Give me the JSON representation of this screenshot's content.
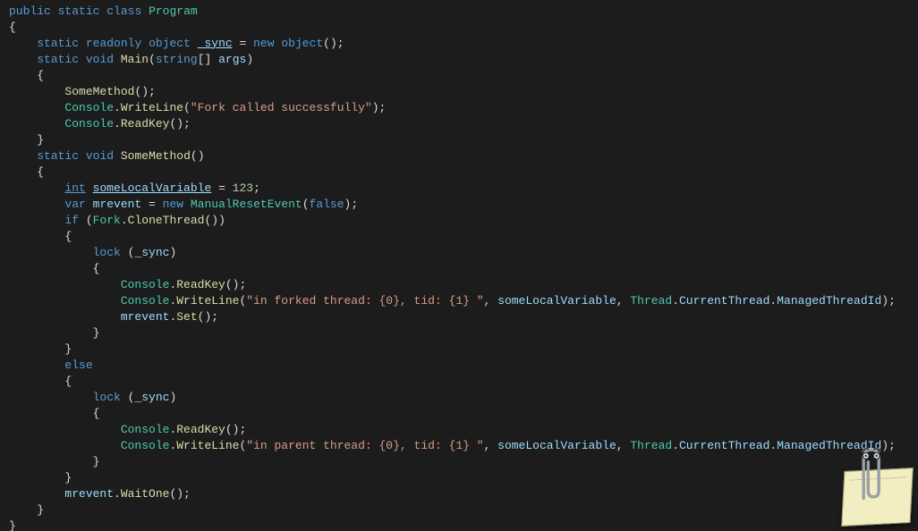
{
  "code": {
    "lines": [
      {
        "indent": 0,
        "tokens": [
          {
            "c": "kw",
            "t": "public"
          },
          {
            "c": "punct",
            "t": " "
          },
          {
            "c": "kw",
            "t": "static"
          },
          {
            "c": "punct",
            "t": " "
          },
          {
            "c": "kw",
            "t": "class"
          },
          {
            "c": "punct",
            "t": " "
          },
          {
            "c": "type",
            "t": "Program"
          }
        ]
      },
      {
        "indent": 0,
        "tokens": [
          {
            "c": "punct",
            "t": "{"
          }
        ]
      },
      {
        "indent": 1,
        "tokens": [
          {
            "c": "kw",
            "t": "static"
          },
          {
            "c": "punct",
            "t": " "
          },
          {
            "c": "kw",
            "t": "readonly"
          },
          {
            "c": "punct",
            "t": " "
          },
          {
            "c": "kw",
            "t": "object"
          },
          {
            "c": "punct",
            "t": " "
          },
          {
            "c": "var underline",
            "t": "_sync"
          },
          {
            "c": "punct",
            "t": " = "
          },
          {
            "c": "kw",
            "t": "new"
          },
          {
            "c": "punct",
            "t": " "
          },
          {
            "c": "kw",
            "t": "object"
          },
          {
            "c": "punct",
            "t": "();"
          }
        ]
      },
      {
        "indent": 0,
        "tokens": [
          {
            "c": "punct",
            "t": ""
          }
        ]
      },
      {
        "indent": 1,
        "tokens": [
          {
            "c": "kw",
            "t": "static"
          },
          {
            "c": "punct",
            "t": " "
          },
          {
            "c": "kw",
            "t": "void"
          },
          {
            "c": "punct",
            "t": " "
          },
          {
            "c": "method",
            "t": "Main"
          },
          {
            "c": "punct",
            "t": "("
          },
          {
            "c": "kw",
            "t": "string"
          },
          {
            "c": "punct",
            "t": "[] "
          },
          {
            "c": "var",
            "t": "args"
          },
          {
            "c": "punct",
            "t": ")"
          }
        ]
      },
      {
        "indent": 1,
        "tokens": [
          {
            "c": "punct",
            "t": "{"
          }
        ]
      },
      {
        "indent": 2,
        "tokens": [
          {
            "c": "method",
            "t": "SomeMethod"
          },
          {
            "c": "punct",
            "t": "();"
          }
        ]
      },
      {
        "indent": 2,
        "tokens": [
          {
            "c": "type",
            "t": "Console"
          },
          {
            "c": "punct",
            "t": "."
          },
          {
            "c": "method",
            "t": "WriteLine"
          },
          {
            "c": "punct",
            "t": "("
          },
          {
            "c": "str",
            "t": "\"Fork called successfully\""
          },
          {
            "c": "punct",
            "t": ");"
          }
        ]
      },
      {
        "indent": 2,
        "tokens": [
          {
            "c": "type",
            "t": "Console"
          },
          {
            "c": "punct",
            "t": "."
          },
          {
            "c": "method",
            "t": "ReadKey"
          },
          {
            "c": "punct",
            "t": "();"
          }
        ]
      },
      {
        "indent": 1,
        "tokens": [
          {
            "c": "punct",
            "t": "}"
          }
        ]
      },
      {
        "indent": 0,
        "tokens": [
          {
            "c": "punct",
            "t": ""
          }
        ]
      },
      {
        "indent": 1,
        "tokens": [
          {
            "c": "kw",
            "t": "static"
          },
          {
            "c": "punct",
            "t": " "
          },
          {
            "c": "kw",
            "t": "void"
          },
          {
            "c": "punct",
            "t": " "
          },
          {
            "c": "method",
            "t": "SomeMethod"
          },
          {
            "c": "punct",
            "t": "()"
          }
        ]
      },
      {
        "indent": 1,
        "tokens": [
          {
            "c": "punct",
            "t": "{"
          }
        ]
      },
      {
        "indent": 2,
        "tokens": [
          {
            "c": "kw underline",
            "t": "int"
          },
          {
            "c": "punct",
            "t": " "
          },
          {
            "c": "var underline",
            "t": "someLocalVariable"
          },
          {
            "c": "punct",
            "t": " = "
          },
          {
            "c": "num",
            "t": "123"
          },
          {
            "c": "punct",
            "t": ";"
          }
        ]
      },
      {
        "indent": 2,
        "tokens": [
          {
            "c": "kw",
            "t": "var"
          },
          {
            "c": "punct",
            "t": " "
          },
          {
            "c": "var",
            "t": "mrevent"
          },
          {
            "c": "punct",
            "t": " = "
          },
          {
            "c": "kw",
            "t": "new"
          },
          {
            "c": "punct",
            "t": " "
          },
          {
            "c": "type",
            "t": "ManualResetEvent"
          },
          {
            "c": "punct",
            "t": "("
          },
          {
            "c": "kw",
            "t": "false"
          },
          {
            "c": "punct",
            "t": ");"
          }
        ]
      },
      {
        "indent": 0,
        "tokens": [
          {
            "c": "punct",
            "t": ""
          }
        ]
      },
      {
        "indent": 2,
        "tokens": [
          {
            "c": "kw",
            "t": "if"
          },
          {
            "c": "punct",
            "t": " ("
          },
          {
            "c": "type",
            "t": "Fork"
          },
          {
            "c": "punct",
            "t": "."
          },
          {
            "c": "method",
            "t": "CloneThread"
          },
          {
            "c": "punct",
            "t": "())"
          }
        ]
      },
      {
        "indent": 2,
        "tokens": [
          {
            "c": "punct",
            "t": "{"
          }
        ]
      },
      {
        "indent": 3,
        "tokens": [
          {
            "c": "kw",
            "t": "lock"
          },
          {
            "c": "punct",
            "t": " ("
          },
          {
            "c": "var",
            "t": "_sync"
          },
          {
            "c": "punct",
            "t": ")"
          }
        ]
      },
      {
        "indent": 3,
        "tokens": [
          {
            "c": "punct",
            "t": "{"
          }
        ]
      },
      {
        "indent": 4,
        "tokens": [
          {
            "c": "type",
            "t": "Console"
          },
          {
            "c": "punct",
            "t": "."
          },
          {
            "c": "method",
            "t": "ReadKey"
          },
          {
            "c": "punct",
            "t": "();"
          }
        ]
      },
      {
        "indent": 4,
        "tokens": [
          {
            "c": "type",
            "t": "Console"
          },
          {
            "c": "punct",
            "t": "."
          },
          {
            "c": "method",
            "t": "WriteLine"
          },
          {
            "c": "punct",
            "t": "("
          },
          {
            "c": "str",
            "t": "\"in forked thread: {0}, tid: {1} \""
          },
          {
            "c": "punct",
            "t": ", "
          },
          {
            "c": "var",
            "t": "someLocalVariable"
          },
          {
            "c": "punct",
            "t": ", "
          },
          {
            "c": "type",
            "t": "Thread"
          },
          {
            "c": "punct",
            "t": "."
          },
          {
            "c": "var",
            "t": "CurrentThread"
          },
          {
            "c": "punct",
            "t": "."
          },
          {
            "c": "var",
            "t": "ManagedThreadId"
          },
          {
            "c": "punct",
            "t": ");"
          }
        ]
      },
      {
        "indent": 4,
        "tokens": [
          {
            "c": "var",
            "t": "mrevent"
          },
          {
            "c": "punct",
            "t": "."
          },
          {
            "c": "method",
            "t": "Set"
          },
          {
            "c": "punct",
            "t": "();"
          }
        ]
      },
      {
        "indent": 3,
        "tokens": [
          {
            "c": "punct",
            "t": "}"
          }
        ]
      },
      {
        "indent": 2,
        "tokens": [
          {
            "c": "punct",
            "t": "}"
          }
        ]
      },
      {
        "indent": 2,
        "tokens": [
          {
            "c": "kw",
            "t": "else"
          }
        ]
      },
      {
        "indent": 2,
        "tokens": [
          {
            "c": "punct",
            "t": "{"
          }
        ]
      },
      {
        "indent": 3,
        "tokens": [
          {
            "c": "kw",
            "t": "lock"
          },
          {
            "c": "punct",
            "t": " ("
          },
          {
            "c": "var",
            "t": "_sync"
          },
          {
            "c": "punct",
            "t": ")"
          }
        ]
      },
      {
        "indent": 3,
        "tokens": [
          {
            "c": "punct",
            "t": "{"
          }
        ]
      },
      {
        "indent": 4,
        "tokens": [
          {
            "c": "type",
            "t": "Console"
          },
          {
            "c": "punct",
            "t": "."
          },
          {
            "c": "method",
            "t": "ReadKey"
          },
          {
            "c": "punct",
            "t": "();"
          }
        ]
      },
      {
        "indent": 4,
        "tokens": [
          {
            "c": "type",
            "t": "Console"
          },
          {
            "c": "punct",
            "t": "."
          },
          {
            "c": "method",
            "t": "WriteLine"
          },
          {
            "c": "punct",
            "t": "("
          },
          {
            "c": "str",
            "t": "\"in parent thread: {0}, tid: {1} \""
          },
          {
            "c": "punct",
            "t": ", "
          },
          {
            "c": "var",
            "t": "someLocalVariable"
          },
          {
            "c": "punct",
            "t": ", "
          },
          {
            "c": "type",
            "t": "Thread"
          },
          {
            "c": "punct",
            "t": "."
          },
          {
            "c": "var",
            "t": "CurrentThread"
          },
          {
            "c": "punct",
            "t": "."
          },
          {
            "c": "var",
            "t": "ManagedThreadId"
          },
          {
            "c": "punct",
            "t": ");"
          }
        ]
      },
      {
        "indent": 3,
        "tokens": [
          {
            "c": "punct",
            "t": "}"
          }
        ]
      },
      {
        "indent": 2,
        "tokens": [
          {
            "c": "punct",
            "t": "}"
          }
        ]
      },
      {
        "indent": 0,
        "tokens": [
          {
            "c": "punct",
            "t": ""
          }
        ]
      },
      {
        "indent": 2,
        "tokens": [
          {
            "c": "var",
            "t": "mrevent"
          },
          {
            "c": "punct",
            "t": "."
          },
          {
            "c": "method",
            "t": "WaitOne"
          },
          {
            "c": "punct",
            "t": "();"
          }
        ]
      },
      {
        "indent": 1,
        "tokens": [
          {
            "c": "punct",
            "t": "}"
          }
        ]
      },
      {
        "indent": 0,
        "tokens": [
          {
            "c": "punct",
            "t": "}"
          }
        ]
      }
    ],
    "indent_unit": "    "
  },
  "assistant": {
    "name": "clippy-assistant"
  }
}
